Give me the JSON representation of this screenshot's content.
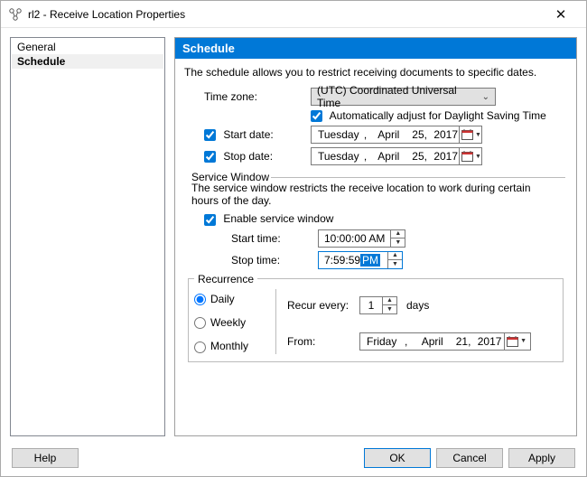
{
  "window": {
    "title": "rl2 - Receive Location Properties"
  },
  "nav": {
    "items": [
      "General",
      "Schedule"
    ],
    "selected": "Schedule"
  },
  "header": "Schedule",
  "description": "The schedule allows you to restrict receiving documents to specific dates.",
  "timezone": {
    "label": "Time zone:",
    "value": "(UTC) Coordinated Universal Time",
    "dst_label": "Automatically adjust for Daylight Saving Time",
    "dst_checked": true
  },
  "start_date": {
    "enabled": true,
    "label": "Start date:",
    "weekday": "Tuesday",
    "month": "April",
    "day": "25,",
    "year": "2017"
  },
  "stop_date": {
    "enabled": true,
    "label": "Stop date:",
    "weekday": "Tuesday",
    "month": "April",
    "day": "25,",
    "year": "2017"
  },
  "service_window": {
    "group_label": "Service Window",
    "description": "The service window restricts the receive location to work during certain hours of the day.",
    "enable_label": "Enable service window",
    "enabled": true,
    "start_label": "Start time:",
    "start_value": "10:00:00 AM",
    "stop_label": "Stop time:",
    "stop_prefix": "7:59:59 ",
    "stop_sel": "PM"
  },
  "recurrence": {
    "group_label": "Recurrence",
    "daily": "Daily",
    "weekly": "Weekly",
    "monthly": "Monthly",
    "selected": "Daily",
    "recur_every_label": "Recur every:",
    "recur_value": "1",
    "recur_unit": "days",
    "from_label": "From:",
    "from_weekday": "Friday",
    "from_month": "April",
    "from_day": "21,",
    "from_year": "2017"
  },
  "buttons": {
    "help": "Help",
    "ok": "OK",
    "cancel": "Cancel",
    "apply": "Apply"
  }
}
